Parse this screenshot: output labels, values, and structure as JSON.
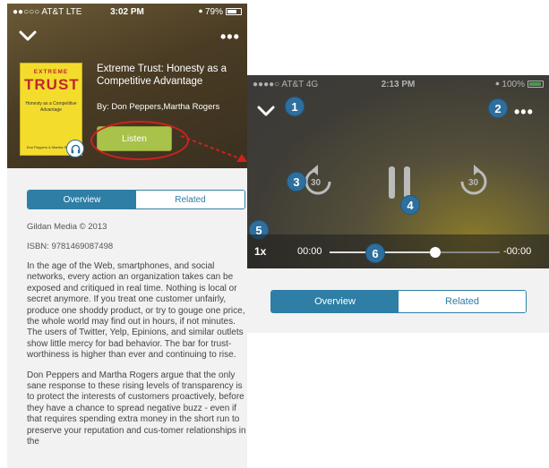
{
  "left": {
    "status": {
      "carrier": "●●○○○ AT&T  LTE",
      "time": "3:02 PM",
      "battery": "79%"
    },
    "more_icon": "•••",
    "cover": {
      "line1": "EXTREME",
      "line2": "TRUST",
      "line3": "Honesty as a Competitive Advantage",
      "line4": "Don Peppers & Martha Rogers"
    },
    "title": "Extreme Trust: Honesty as a Competitive Advantage",
    "authors": "By: Don Peppers,Martha Rogers",
    "listen_label": "Listen",
    "tabs": [
      {
        "label": "Overview"
      },
      {
        "label": "Related"
      }
    ],
    "publisher": "Gildan Media © 2013",
    "isbn": "ISBN: 9781469087498",
    "paragraph1": "In the age of the Web, smartphones, and social networks, every action an organization takes can be exposed and critiqued in real time. Nothing is local or secret anymore. If you treat one customer unfairly, produce one shoddy product, or try to gouge one price, the whole world may find out in hours, if not minutes. The users of Twitter, Yelp, Epinions, and similar outlets show little mercy for bad behavior. The bar for trust-worthiness is higher than ever and continuing to rise.",
    "paragraph2": "Don Peppers and Martha Rogers argue that the only sane response to these rising levels of transparency is to protect the interests of customers proactively, before they have a chance to spread negative buzz - even if that requires spending extra money in the short run to preserve your reputation and cus-tomer relationships in the"
  },
  "right": {
    "status": {
      "carrier": "●●●●○ AT&T  4G",
      "time": "2:13 PM",
      "battery": "100%"
    },
    "more_icon": "•••",
    "skip_back_label": "30",
    "skip_forward_label": "30",
    "rate": "1x",
    "elapsed": "00:00",
    "remaining": "-00:00",
    "progress_fraction": 0.62,
    "tabs": [
      {
        "label": "Overview"
      },
      {
        "label": "Related"
      }
    ],
    "badges": [
      "1",
      "2",
      "3",
      "4",
      "5",
      "6"
    ]
  },
  "colors": {
    "accent": "#2e7ea6",
    "listen": "#a8c24a",
    "highlight": "#d02020",
    "badge": "#2e6f9e"
  }
}
